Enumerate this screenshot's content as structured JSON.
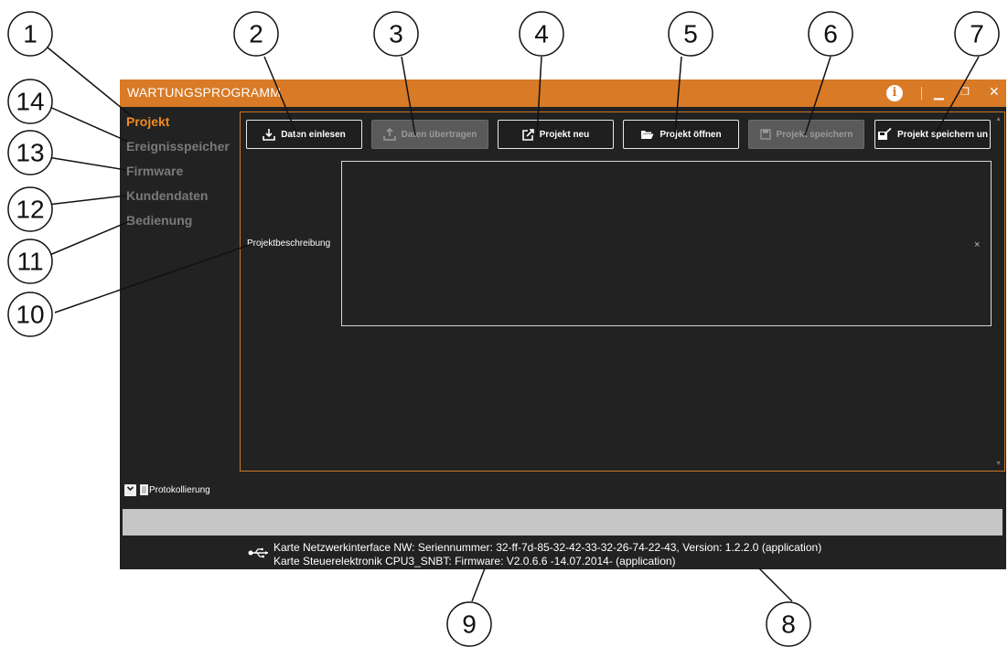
{
  "window": {
    "title": "WARTUNGSPROGRAMM",
    "accent_color": "#d87a26",
    "title_controls": [
      "info-icon",
      "minimize-icon",
      "restore-icon",
      "close-icon"
    ]
  },
  "sidebar": {
    "items": [
      {
        "label": "Projekt",
        "active": true
      },
      {
        "label": "Ereignisspeicher",
        "active": false
      },
      {
        "label": "Firmware",
        "active": false
      },
      {
        "label": "Kundendaten",
        "active": false
      },
      {
        "label": "Bedienung",
        "active": false
      }
    ]
  },
  "toolbar": {
    "buttons": [
      {
        "label": "Daten einlesen",
        "icon": "download-tray-icon",
        "enabled": true
      },
      {
        "label": "Daten übertragen",
        "icon": "upload-tray-icon",
        "enabled": false
      },
      {
        "label": "Projekt neu",
        "icon": "new-external-icon",
        "enabled": true
      },
      {
        "label": "Projekt öffnen",
        "icon": "folder-open-icon",
        "enabled": true
      },
      {
        "label": "Projekt speichern",
        "icon": "save-icon",
        "enabled": false
      },
      {
        "label": "Projekt speichern un",
        "icon": "save-as-icon",
        "enabled": true
      }
    ]
  },
  "project": {
    "description_label": "Projektbeschreibung",
    "description_value": "",
    "clear_symbol": "×"
  },
  "log": {
    "label": "Protokollierung",
    "toggle_symbol": "⌄"
  },
  "status": {
    "lines": [
      "Karte Netzwerkinterface NW: Seriennummer: 32-ff-7d-85-32-42-33-32-26-74-22-43, Version: 1.2.2.0 (application)",
      "Karte Steuerelektronik CPU3_SNBT: Firmware: V2.0.6.6 -14.07.2014-  (application)"
    ],
    "icon": "usb-icon"
  },
  "callouts": [
    "1",
    "2",
    "3",
    "4",
    "5",
    "6",
    "7",
    "8",
    "9",
    "10",
    "11",
    "12",
    "13",
    "14"
  ]
}
